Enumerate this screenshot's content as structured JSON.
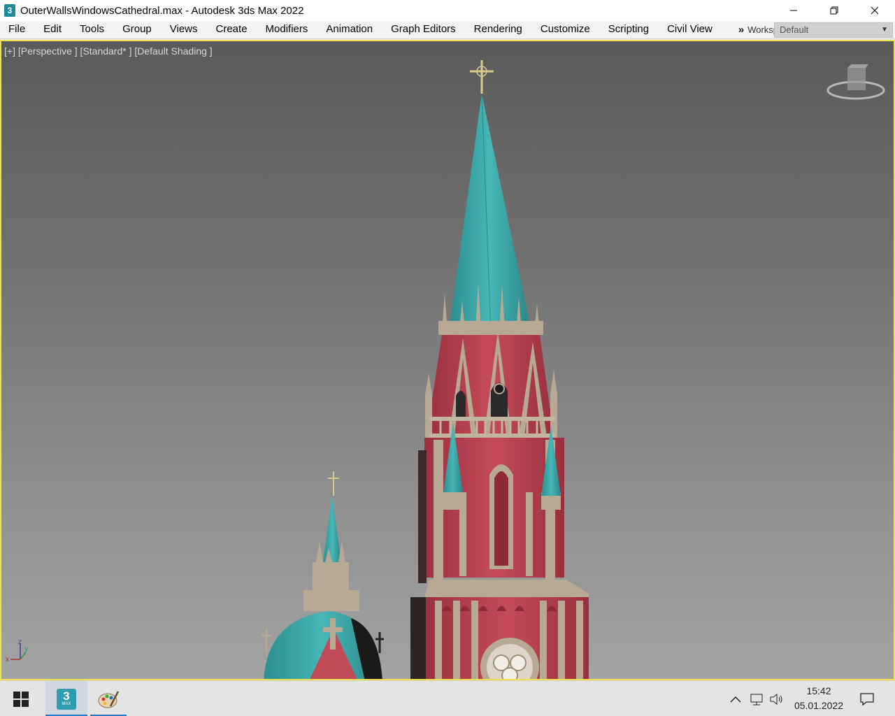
{
  "window": {
    "title": "OuterWallsWindowsCathedral.max - Autodesk 3ds Max 2022",
    "app_icon_label": "3"
  },
  "menu": {
    "items": [
      "File",
      "Edit",
      "Tools",
      "Group",
      "Views",
      "Create",
      "Modifiers",
      "Animation",
      "Graph Editors",
      "Rendering",
      "Customize",
      "Scripting",
      "Civil View"
    ],
    "overflow": "»",
    "workspaces_label": "Workspaces:",
    "workspace_value": "Default"
  },
  "viewport": {
    "label": "[+] [Perspective ] [Standard* ] [Default Shading ]",
    "border_color": "#f0e24a",
    "viewcube_icon": "viewcube-icon",
    "axis_labels": {
      "x": "x",
      "y": "y",
      "z": "z"
    }
  },
  "taskbar": {
    "max_tile_label": "3",
    "max_tile_sub": "MAX",
    "time": "15:42",
    "date": "05.01.2022"
  },
  "colors": {
    "roof_teal": "#3aa7a8",
    "brick_red": "#b8404e",
    "stone": "#b7a993",
    "accent": "#2a78c8"
  }
}
